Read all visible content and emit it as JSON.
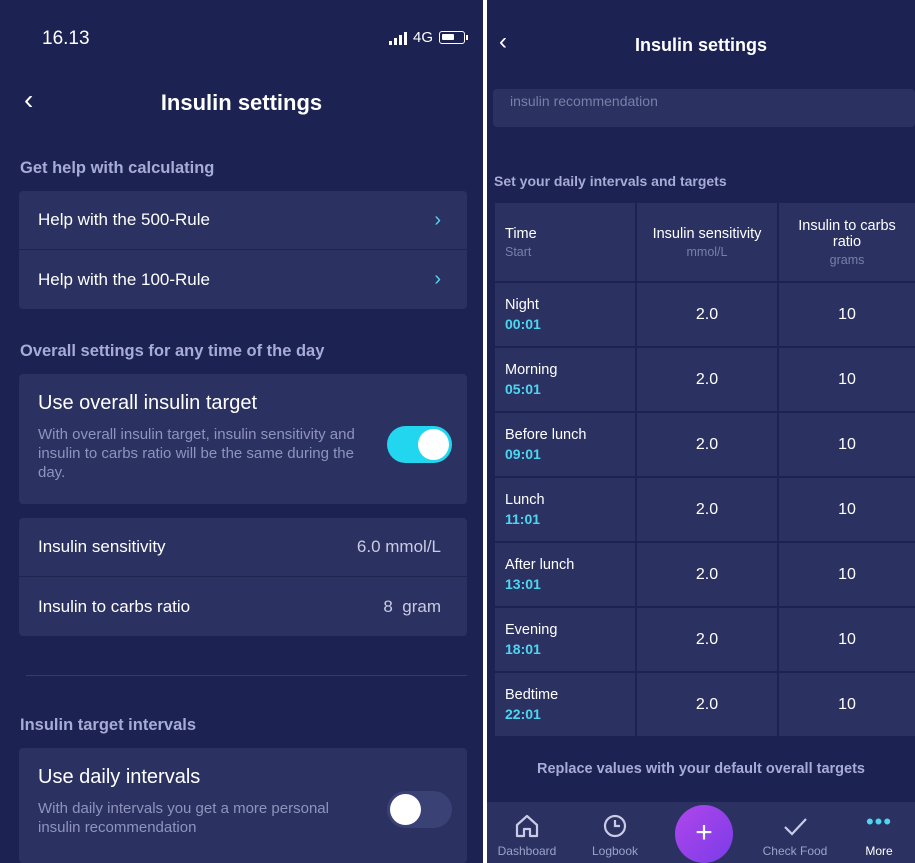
{
  "left": {
    "status": {
      "time": "16.13",
      "network": "4G"
    },
    "nav": {
      "title": "Insulin settings"
    },
    "help_section": {
      "title": "Get help with calculating",
      "items": [
        {
          "label": "Help with the 500-Rule"
        },
        {
          "label": "Help with the 100-Rule"
        }
      ]
    },
    "overall_section": {
      "title": "Overall settings for any time of the day",
      "toggle_title": "Use overall insulin target",
      "toggle_desc": "With overall insulin target, insulin sensitivity and insulin to carbs ratio will be the same during the day.",
      "toggle_on": true,
      "rows": [
        {
          "label": "Insulin sensitivity",
          "value": "6.0 mmol/L"
        },
        {
          "label": "Insulin to carbs ratio",
          "value": "8  gram"
        }
      ]
    },
    "intervals_section": {
      "title": "Insulin target intervals",
      "toggle_title": "Use daily intervals",
      "toggle_desc": "With daily intervals you get a more personal insulin recommendation",
      "toggle_on": false
    }
  },
  "right": {
    "nav": {
      "title": "Insulin settings"
    },
    "faded_text": "insulin recommendation",
    "section_title": "Set your daily intervals and targets",
    "table": {
      "headers": [
        {
          "title": "Time",
          "sub": "Start"
        },
        {
          "title": "Insulin sensitivity",
          "sub": "mmol/L"
        },
        {
          "title": "Insulin to carbs ratio",
          "sub": "grams"
        }
      ],
      "rows": [
        {
          "name": "Night",
          "time": "00:01",
          "sensitivity": "2.0",
          "ratio": "10"
        },
        {
          "name": "Morning",
          "time": "05:01",
          "sensitivity": "2.0",
          "ratio": "10"
        },
        {
          "name": "Before lunch",
          "time": "09:01",
          "sensitivity": "2.0",
          "ratio": "10"
        },
        {
          "name": "Lunch",
          "time": "11:01",
          "sensitivity": "2.0",
          "ratio": "10"
        },
        {
          "name": "After lunch",
          "time": "13:01",
          "sensitivity": "2.0",
          "ratio": "10"
        },
        {
          "name": "Evening",
          "time": "18:01",
          "sensitivity": "2.0",
          "ratio": "10"
        },
        {
          "name": "Bedtime",
          "time": "22:01",
          "sensitivity": "2.0",
          "ratio": "10"
        }
      ]
    },
    "replace_label": "Replace values with your default overall targets",
    "tabs": [
      {
        "label": "Dashboard",
        "icon": "home-icon"
      },
      {
        "label": "Logbook",
        "icon": "clock-icon"
      },
      {
        "label": "Check Food",
        "icon": "check-icon"
      },
      {
        "label": "More",
        "icon": "more-icon"
      }
    ],
    "fab_label": "+"
  },
  "colors": {
    "background": "#1c2251",
    "card": "#2b3261",
    "accent": "#4fd6ef",
    "fab": "#9b42ea"
  }
}
